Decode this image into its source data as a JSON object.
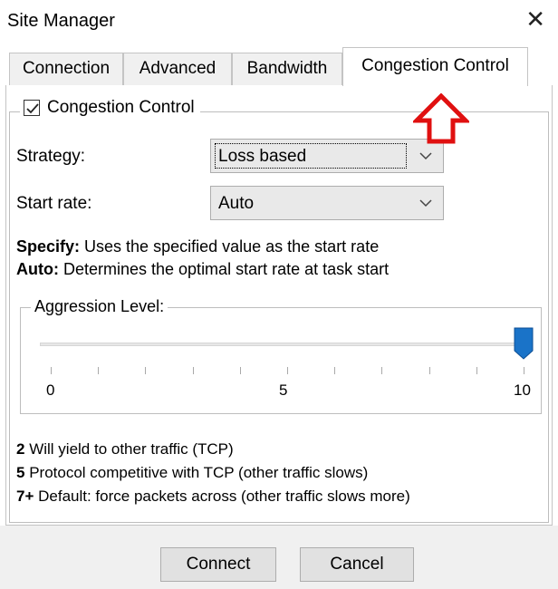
{
  "window": {
    "title": "Site Manager"
  },
  "tabs": [
    {
      "label": "Connection"
    },
    {
      "label": "Advanced"
    },
    {
      "label": "Bandwidth"
    },
    {
      "label": "Congestion Control"
    }
  ],
  "group": {
    "label": "Congestion Control",
    "checked": true
  },
  "strategy": {
    "label": "Strategy:",
    "value": "Loss based"
  },
  "start_rate": {
    "label": "Start rate:",
    "value": "Auto"
  },
  "descriptions": {
    "specify_key": "Specify:",
    "specify_text": " Uses the specified value as the start rate",
    "auto_key": "Auto:",
    "auto_text": " Determines the optimal start rate at task start"
  },
  "aggression": {
    "label": "Aggression Level:",
    "min_label": "0",
    "mid_label": "5",
    "max_label": "10",
    "value": 10,
    "min": 0,
    "max": 10
  },
  "levels": [
    {
      "key": "2",
      "text": " Will yield to other traffic (TCP)"
    },
    {
      "key": "5",
      "text": " Protocol competitive with TCP (other traffic slows)"
    },
    {
      "key": "7+",
      "text": " Default: force packets across (other traffic slows more)"
    }
  ],
  "buttons": {
    "connect": "Connect",
    "cancel": "Cancel"
  },
  "colors": {
    "slider_thumb": "#1a73c8",
    "annotation_arrow": "#e01010",
    "face": "#f0f0f0"
  },
  "icons": {
    "close": "close-icon",
    "dropdown": "chevron-down-icon",
    "arrow": "up-arrow-icon"
  }
}
